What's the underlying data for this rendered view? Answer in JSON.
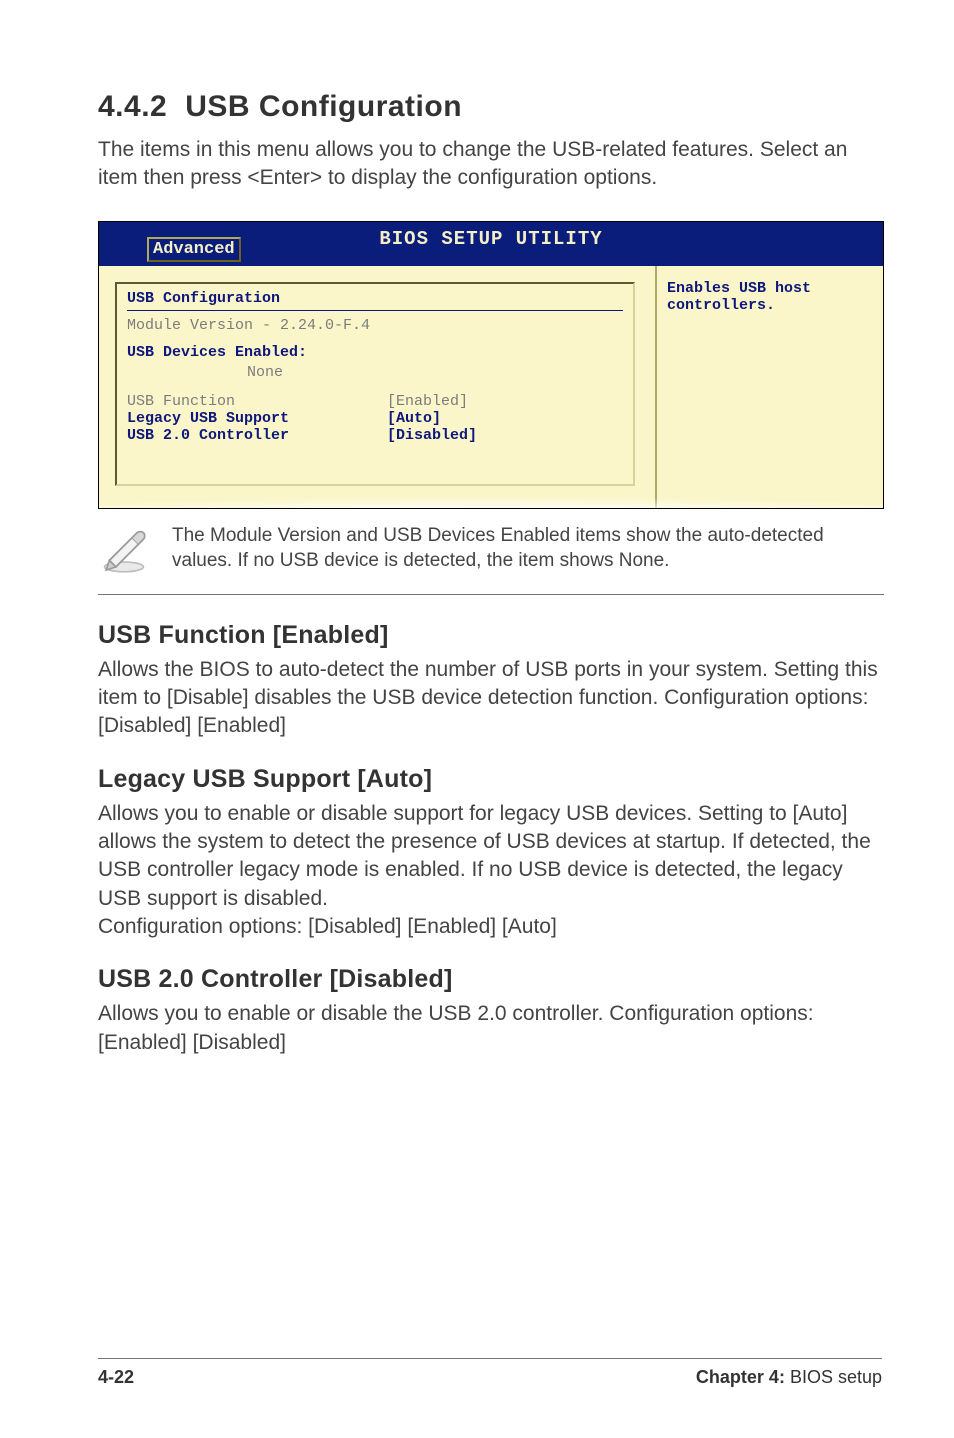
{
  "section": {
    "number": "4.4.2",
    "title": "USB Configuration",
    "intro": "The items in this menu allows you to change the USB-related features. Select an item then press <Enter> to display the configuration options."
  },
  "bios": {
    "banner": "BIOS SETUP UTILITY",
    "tab": "Advanced",
    "panel_title": "USB Configuration",
    "module_version_label": "Module Version - 2.24.0-F.4",
    "devices_label": "USB Devices Enabled:",
    "devices_value": "None",
    "rows": [
      {
        "label": "USB Function",
        "value": "[Enabled]"
      },
      {
        "label": "Legacy USB Support",
        "value": "[Auto]"
      },
      {
        "label": "USB 2.0 Controller",
        "value": "[Disabled]"
      }
    ],
    "help": "Enables USB host controllers."
  },
  "note": "The Module Version and USB Devices Enabled items show the auto-detected values. If no USB device is detected, the item shows None.",
  "settings": [
    {
      "heading": "USB Function [Enabled]",
      "body": "Allows the BIOS to auto-detect the number of USB ports in your system. Setting this item to [Disable] disables the USB device detection function. Configuration options: [Disabled] [Enabled]"
    },
    {
      "heading": "Legacy USB Support [Auto]",
      "body": "Allows you to enable or disable support for legacy USB devices. Setting to [Auto] allows the system to detect the presence of USB devices at startup. If detected, the USB controller legacy mode is enabled. If no USB device is detected, the legacy USB support is disabled.\nConfiguration options: [Disabled] [Enabled] [Auto]"
    },
    {
      "heading": "USB 2.0 Controller [Disabled]",
      "body": "Allows you to enable or disable the USB 2.0 controller. Configuration options: [Enabled] [Disabled]"
    }
  ],
  "footer": {
    "page": "4-22",
    "chapter_bold": "Chapter 4:",
    "chapter_rest": " BIOS setup"
  }
}
